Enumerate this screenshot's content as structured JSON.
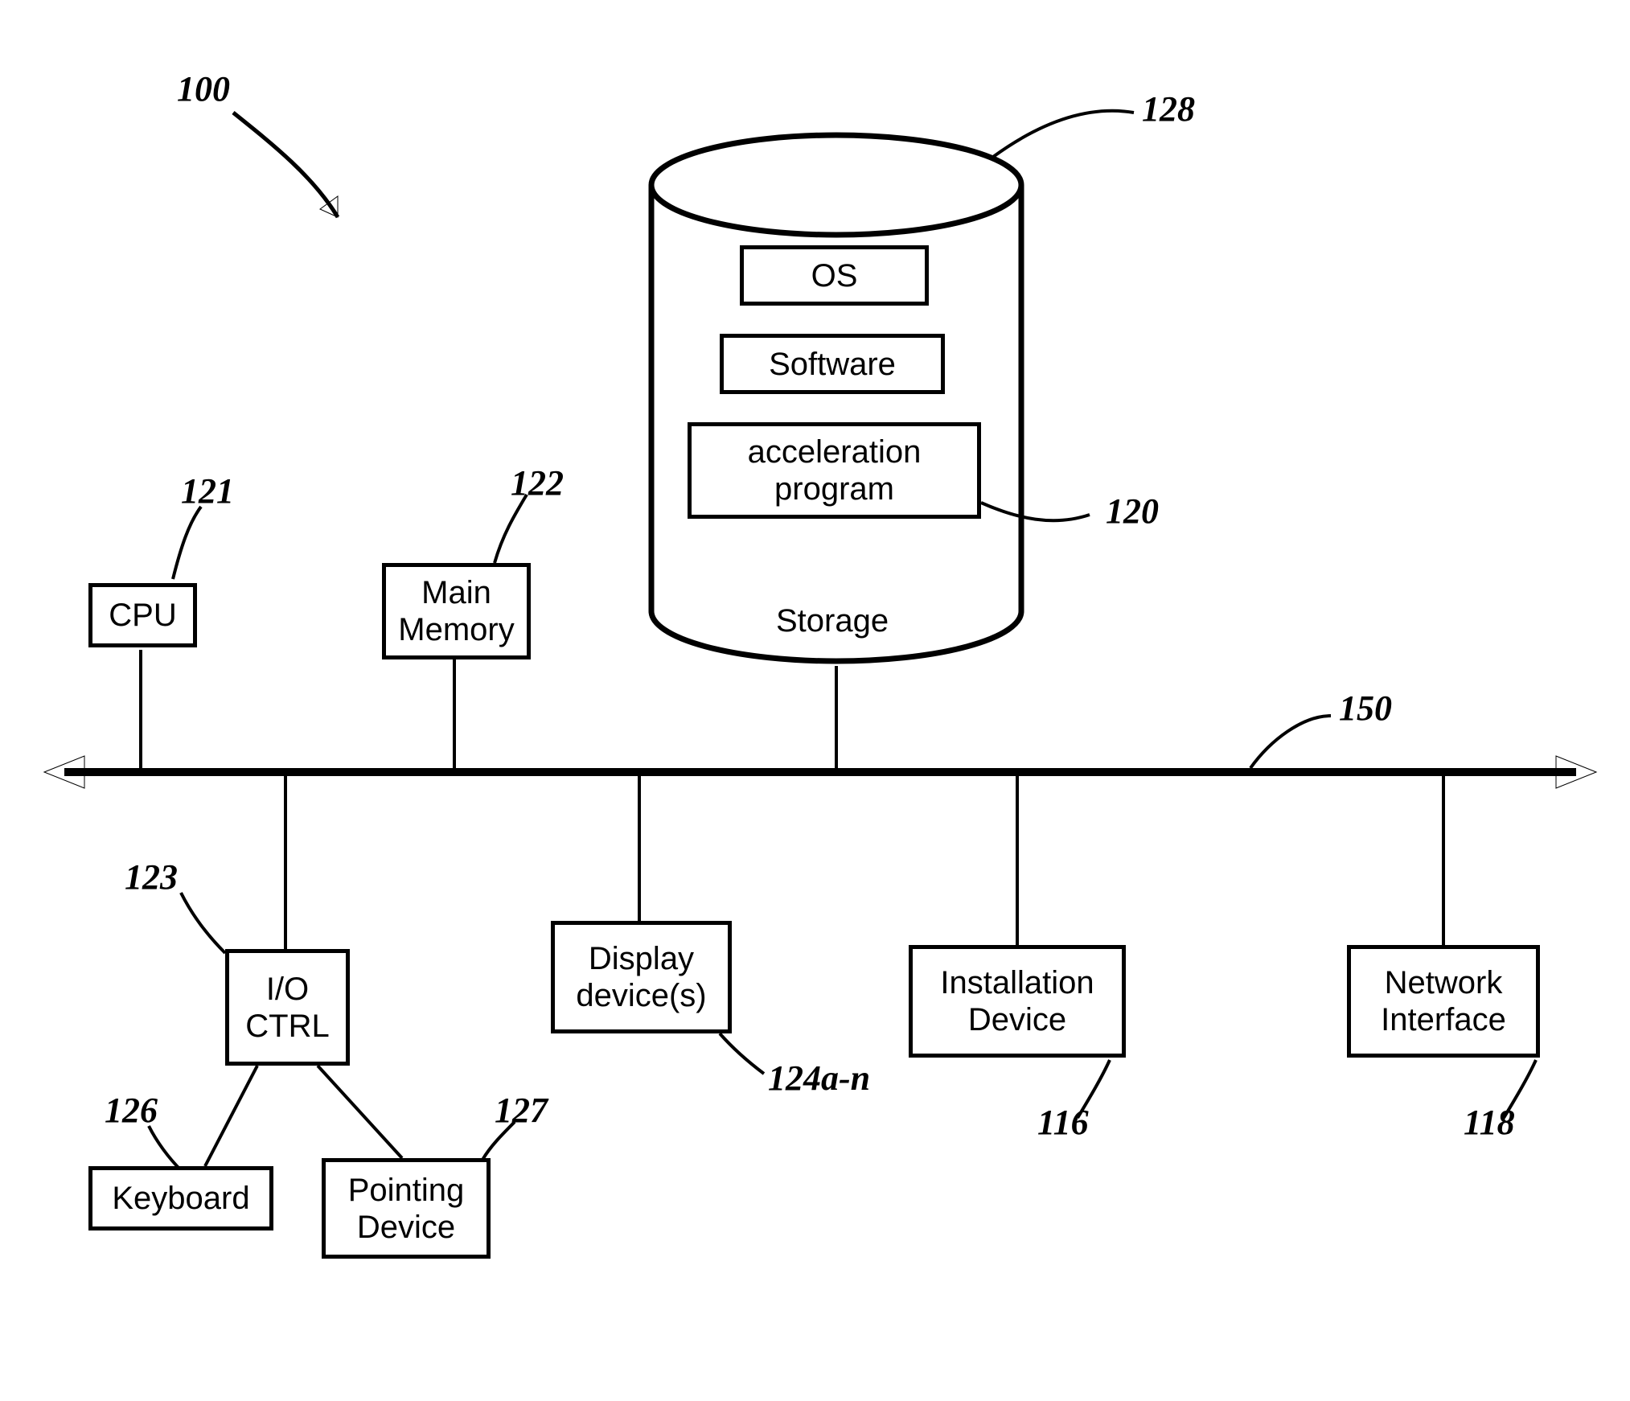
{
  "figure": {
    "ref_main": "100",
    "bus_ref": "150",
    "cpu": {
      "label": "CPU",
      "ref": "121"
    },
    "memory": {
      "label": "Main\nMemory",
      "ref": "122"
    },
    "storage": {
      "label": "Storage",
      "ref": "128",
      "os": "OS",
      "software": "Software",
      "accel": "acceleration\nprogram",
      "accel_ref": "120"
    },
    "ioctrl": {
      "label": "I/O\nCTRL",
      "ref": "123"
    },
    "keyboard": {
      "label": "Keyboard",
      "ref": "126"
    },
    "pointing": {
      "label": "Pointing\nDevice",
      "ref": "127"
    },
    "display": {
      "label": "Display\ndevice(s)",
      "ref": "124a-n"
    },
    "install": {
      "label": "Installation\nDevice",
      "ref": "116"
    },
    "network": {
      "label": "Network\nInterface",
      "ref": "118"
    }
  }
}
